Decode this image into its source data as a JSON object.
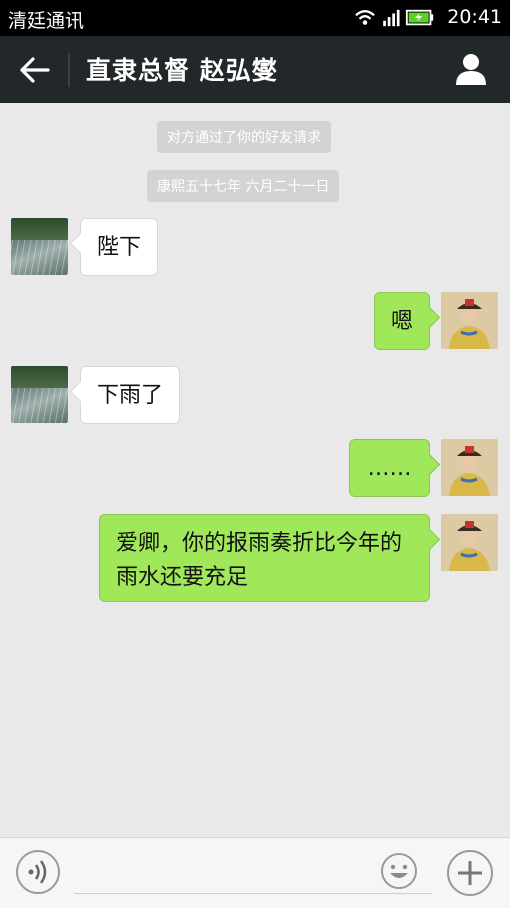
{
  "status_bar": {
    "carrier": "清廷通讯",
    "time": "20:41",
    "icons": [
      "wifi-icon",
      "signal-icon",
      "battery-icon"
    ]
  },
  "header": {
    "title": "直隶总督 赵弘燮",
    "back_icon": "back-arrow-icon",
    "profile_icon": "person-icon"
  },
  "system_notices": [
    "对方通过了你的好友请求",
    "康熙五十七年 六月二十一日"
  ],
  "messages": [
    {
      "side": "left",
      "text": "陛下",
      "avatar": "rain-avatar"
    },
    {
      "side": "right",
      "text": "嗯",
      "avatar": "emperor-avatar"
    },
    {
      "side": "left",
      "text": "下雨了",
      "avatar": "rain-avatar"
    },
    {
      "side": "right",
      "text": "……",
      "avatar": "emperor-avatar"
    },
    {
      "side": "right",
      "text": "爱卿，你的报雨奏折比今年的\n雨水还要充足",
      "avatar": "emperor-avatar"
    }
  ],
  "input_bar": {
    "voice_icon": "voice-icon",
    "emoji_icon": "emoji-icon",
    "plus_icon": "plus-icon",
    "placeholder": ""
  },
  "colors": {
    "title_bar": "#22282a",
    "chat_bg": "#e9e9e9",
    "bubble_right": "#a0e75a",
    "bubble_left": "#ffffff"
  }
}
